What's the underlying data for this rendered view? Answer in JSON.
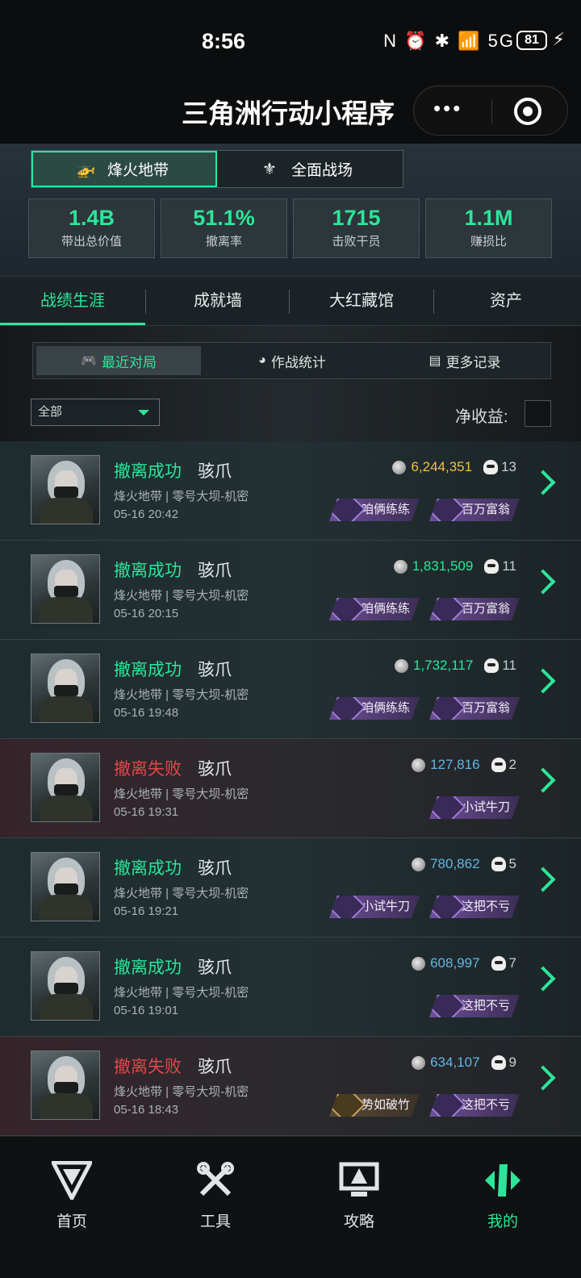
{
  "status_bar": {
    "time": "8:56",
    "battery": "81",
    "icons": "N ⏰ ✱ 📶 5G"
  },
  "title_bar": {
    "title": "三角洲行动小程序",
    "more": "•••"
  },
  "modes": [
    {
      "label": "烽火地带",
      "icon": "helicopter-icon"
    },
    {
      "label": "全面战场",
      "icon": "wings-icon"
    }
  ],
  "stats": [
    {
      "value": "1.4B",
      "label": "带出总价值"
    },
    {
      "value": "51.1%",
      "label": "撤离率"
    },
    {
      "value": "1715",
      "label": "击败干员"
    },
    {
      "value": "1.1M",
      "label": "赚损比"
    }
  ],
  "tabs": [
    "战绩生涯",
    "成就墙",
    "大红藏馆",
    "资产"
  ],
  "subtabs": [
    {
      "label": "最近对局",
      "icon": "🎮"
    },
    {
      "label": "作战统计",
      "icon": "◕"
    },
    {
      "label": "更多记录",
      "icon": "▤"
    }
  ],
  "filter": {
    "value": "全部"
  },
  "net_label": "净收益:",
  "colors": {
    "accent": "#2de59a",
    "fail": "#e2474a",
    "value_gold": "#f1c23c",
    "value_green": "#2de59a",
    "value_blue": "#5fb7e6"
  },
  "matches": [
    {
      "result": "撤离成功",
      "status": "ok",
      "operator": "骇爪",
      "meta": "烽火地带 | 零号大坝-机密",
      "date": "05-16 20:42",
      "value": "6,244,351",
      "value_color": "#f1c23c",
      "kills": "13",
      "badges": [
        {
          "label": "咱俩练练",
          "type": "purple"
        },
        {
          "label": "百万富翁",
          "type": "purple"
        }
      ]
    },
    {
      "result": "撤离成功",
      "status": "ok",
      "operator": "骇爪",
      "meta": "烽火地带 | 零号大坝-机密",
      "date": "05-16 20:15",
      "value": "1,831,509",
      "value_color": "#2de59a",
      "kills": "11",
      "badges": [
        {
          "label": "咱俩练练",
          "type": "purple"
        },
        {
          "label": "百万富翁",
          "type": "purple"
        }
      ]
    },
    {
      "result": "撤离成功",
      "status": "ok",
      "operator": "骇爪",
      "meta": "烽火地带 | 零号大坝-机密",
      "date": "05-16 19:48",
      "value": "1,732,117",
      "value_color": "#2de59a",
      "kills": "11",
      "badges": [
        {
          "label": "咱俩练练",
          "type": "purple"
        },
        {
          "label": "百万富翁",
          "type": "purple"
        }
      ]
    },
    {
      "result": "撤离失败",
      "status": "fail",
      "operator": "骇爪",
      "meta": "烽火地带 | 零号大坝-机密",
      "date": "05-16 19:31",
      "value": "127,816",
      "value_color": "#5fb7e6",
      "kills": "2",
      "badges": [
        {
          "label": "小试牛刀",
          "type": "purple"
        }
      ]
    },
    {
      "result": "撤离成功",
      "status": "ok",
      "operator": "骇爪",
      "meta": "烽火地带 | 零号大坝-机密",
      "date": "05-16 19:21",
      "value": "780,862",
      "value_color": "#5fb7e6",
      "kills": "5",
      "badges": [
        {
          "label": "小试牛刀",
          "type": "purple"
        },
        {
          "label": "这把不亏",
          "type": "purple"
        }
      ]
    },
    {
      "result": "撤离成功",
      "status": "ok",
      "operator": "骇爪",
      "meta": "烽火地带 | 零号大坝-机密",
      "date": "05-16 19:01",
      "value": "608,997",
      "value_color": "#5fb7e6",
      "kills": "7",
      "badges": [
        {
          "label": "这把不亏",
          "type": "purple"
        }
      ]
    },
    {
      "result": "撤离失败",
      "status": "fail",
      "operator": "骇爪",
      "meta": "烽火地带 | 零号大坝-机密",
      "date": "05-16 18:43",
      "value": "634,107",
      "value_color": "#5fb7e6",
      "kills": "9",
      "badges": [
        {
          "label": "势如破竹",
          "type": "gold"
        },
        {
          "label": "这把不亏",
          "type": "purple"
        }
      ]
    }
  ],
  "bottom_nav": [
    {
      "label": "首页",
      "icon": "home-g-icon"
    },
    {
      "label": "工具",
      "icon": "tools-icon"
    },
    {
      "label": "攻略",
      "icon": "guide-icon"
    },
    {
      "label": "我的",
      "icon": "profile-icon",
      "active": true
    }
  ]
}
